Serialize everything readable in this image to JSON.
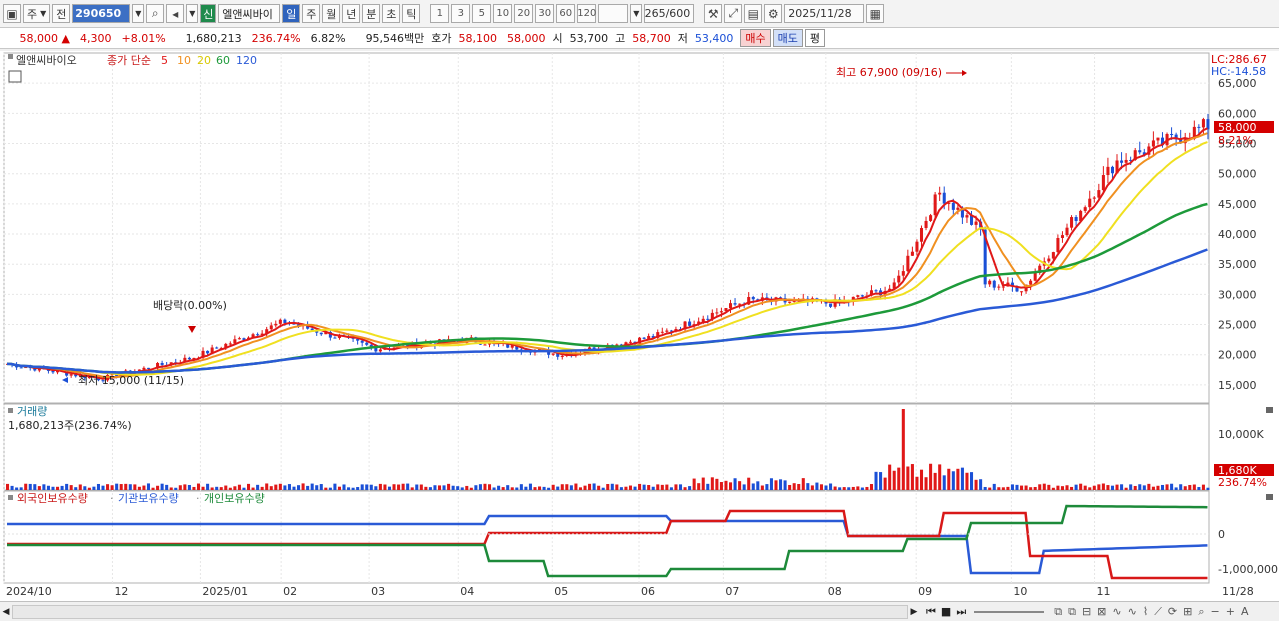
{
  "toolbar": {
    "market": "주",
    "prev": "전",
    "code": "290650",
    "name": "엘앤씨바이",
    "credit_badge": "신",
    "periods": [
      "일",
      "주",
      "월",
      "년",
      "분",
      "초",
      "틱"
    ],
    "active_period": "일",
    "intervals": [
      "1",
      "3",
      "5",
      "10",
      "20",
      "30",
      "60",
      "120"
    ],
    "count": "265",
    "count_max": "/600",
    "date": "2025/11/28"
  },
  "quote": {
    "price": "58,000",
    "change": "4,300",
    "change_pct": "+8.01%",
    "volume": "1,680,213",
    "volume_ratio": "236.74%",
    "turnover": "6.82%",
    "amount": "95,546백만",
    "bid_label": "호가",
    "bid1": "58,100",
    "bid2": "58,000",
    "open_label": "시",
    "open": "53,700",
    "high_label": "고",
    "high": "58,700",
    "low_label": "저",
    "low": "53,400",
    "buy": "매수",
    "sell": "매도",
    "avg": "평"
  },
  "price_panel": {
    "stock_label": "엘앤씨바이오",
    "ma_label": "종가 단순",
    "ma_periods": [
      "5",
      "10",
      "20",
      "60",
      "120"
    ],
    "ma_colors": [
      "#e01818",
      "#f09020",
      "#f0e020",
      "#1d9a3a",
      "#2a5ad6"
    ],
    "lc": "LC:286.67",
    "hc": "HC:-14.58",
    "high_annotation": "최고 67,900 (09/16)",
    "low_annotation": "최저 15,000 (11/15)",
    "dividend_annotation": "배당락(0.00%)",
    "current_price_tag": "58,000",
    "current_pct_tag": "8.21%",
    "y_ticks": [
      "65,000",
      "60,000",
      "55,000",
      "50,000",
      "45,000",
      "40,000",
      "35,000",
      "30,000",
      "25,000",
      "20,000",
      "15,000"
    ]
  },
  "volume_panel": {
    "label": "거래량",
    "value": "1,680,213주(236.74%)",
    "y_tick": "10,000K",
    "tag_value": "1,680K",
    "tag_pct": "236.74%"
  },
  "holding_panel": {
    "foreign": "외국인보유수량",
    "institution": "기관보유수량",
    "individual": "개인보유수량",
    "y_ticks": [
      "0",
      "-1,000,000"
    ]
  },
  "x_axis": [
    "2024/10",
    "12",
    "2025/01",
    "02",
    "03",
    "04",
    "05",
    "06",
    "07",
    "08",
    "09",
    "10",
    "11"
  ],
  "x_axis_end": "11/28",
  "chart_data": {
    "type": "line",
    "title": "엘앤씨바이오",
    "ylim": [
      12000,
      70000
    ],
    "dates": [
      "2024/10",
      "2024/11",
      "2024/12",
      "2025/01",
      "2025/02",
      "2025/03",
      "2025/04",
      "2025/05",
      "2025/06",
      "2025/07",
      "2025/08",
      "2025/09",
      "2025/10",
      "2025/11/28"
    ],
    "series": [
      {
        "name": "종가",
        "values": [
          18500,
          16000,
          19500,
          25500,
          21000,
          22500,
          20000,
          23000,
          29000,
          28500,
          33000,
          31000,
          52000,
          58000
        ]
      }
    ],
    "high": {
      "value": 67900,
      "date": "09/16"
    },
    "low": {
      "value": 15000,
      "date": "11/15"
    }
  }
}
